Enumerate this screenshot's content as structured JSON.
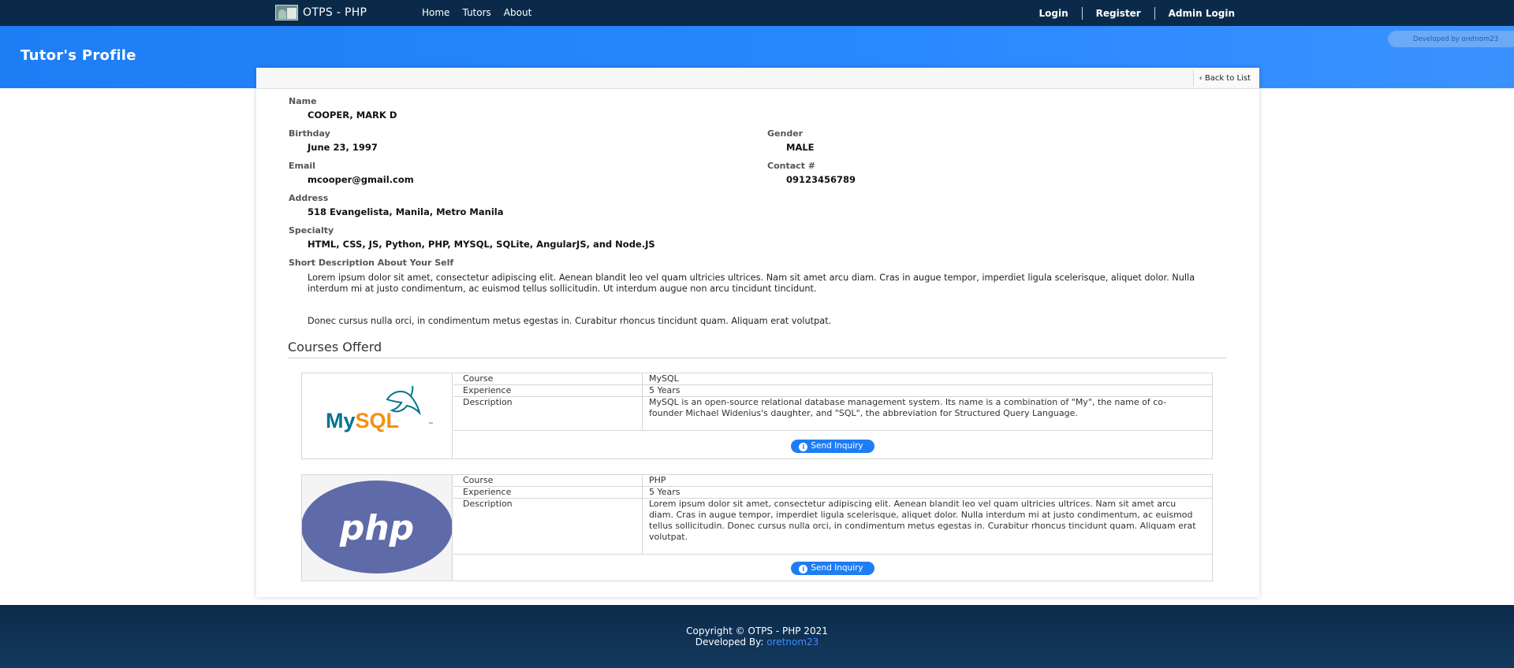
{
  "nav": {
    "brand": "OTPS - PHP",
    "links": [
      "Home",
      "Tutors",
      "About"
    ],
    "right": [
      "Login",
      "Register",
      "Admin Login"
    ]
  },
  "header": {
    "title": "Tutor's Profile",
    "dev_pill": "Developed by oretnom23"
  },
  "card": {
    "back_label": "Back to List"
  },
  "profile": {
    "name_label": "Name",
    "name": "COOPER, MARK D",
    "birthday_label": "Birthday",
    "birthday": "June 23, 1997",
    "gender_label": "Gender",
    "gender": "MALE",
    "email_label": "Email",
    "email": "mcooper@gmail.com",
    "contact_label": "Contact #",
    "contact": "09123456789",
    "address_label": "Address",
    "address": "518 Evangelista, Manila, Metro Manila",
    "specialty_label": "Specialty",
    "specialty": "HTML, CSS, JS, Python, PHP, MYSQL, SQLite, AngularJS, and Node.JS",
    "about_label": "Short Description About Your Self",
    "about_p1": "Lorem ipsum dolor sit amet, consectetur adipiscing elit. Aenean blandit leo vel quam ultricies ultrices. Nam sit amet arcu diam. Cras in augue tempor, imperdiet ligula scelerisque, aliquet dolor. Nulla interdum mi at justo condimentum, ac euismod tellus sollicitudin. Ut interdum augue non arcu tincidunt tincidunt.",
    "about_p2": "Donec cursus nulla orci, in condimentum metus egestas in. Curabitur rhoncus tincidunt quam. Aliquam erat volutpat."
  },
  "courses": {
    "title": "Courses Offerd",
    "row_labels": {
      "course": "Course",
      "experience": "Experience",
      "description": "Description"
    },
    "items": [
      {
        "logo_text": "MySQL",
        "course": "MySQL",
        "experience": "5 Years",
        "description": "MySQL is an open-source relational database management system. Its name is a combination of \"My\", the name of co-founder Michael Widenius's daughter, and \"SQL\", the abbreviation for Structured Query Language.",
        "button": "Send Inquiry"
      },
      {
        "logo_text": "php",
        "course": "PHP",
        "experience": "5 Years",
        "description": "Lorem ipsum dolor sit amet, consectetur adipiscing elit. Aenean blandit leo vel quam ultricies ultrices. Nam sit amet arcu diam. Cras in augue tempor, imperdiet ligula scelerisque, aliquet dolor. Nulla interdum mi at justo condimentum, ac euismod tellus sollicitudin. Donec cursus nulla orci, in condimentum metus egestas in. Curabitur rhoncus tincidunt quam. Aliquam erat volutpat.",
        "button": "Send Inquiry"
      }
    ]
  },
  "footer": {
    "copyright": "Copyright © OTPS - PHP 2021",
    "dev_prefix": "Developed By: ",
    "dev_name": "oretnom23"
  },
  "colors": {
    "nav_bg": "#0b2a4a",
    "header_bg": "#1e7df5",
    "button": "#1e7df5",
    "mysql_blue": "#00758f",
    "mysql_orange": "#f29111",
    "php_purple": "#5f6aa8"
  },
  "icons": [
    "brand-logo-icon",
    "chevron-left-icon",
    "info-icon",
    "dolphin-icon"
  ]
}
